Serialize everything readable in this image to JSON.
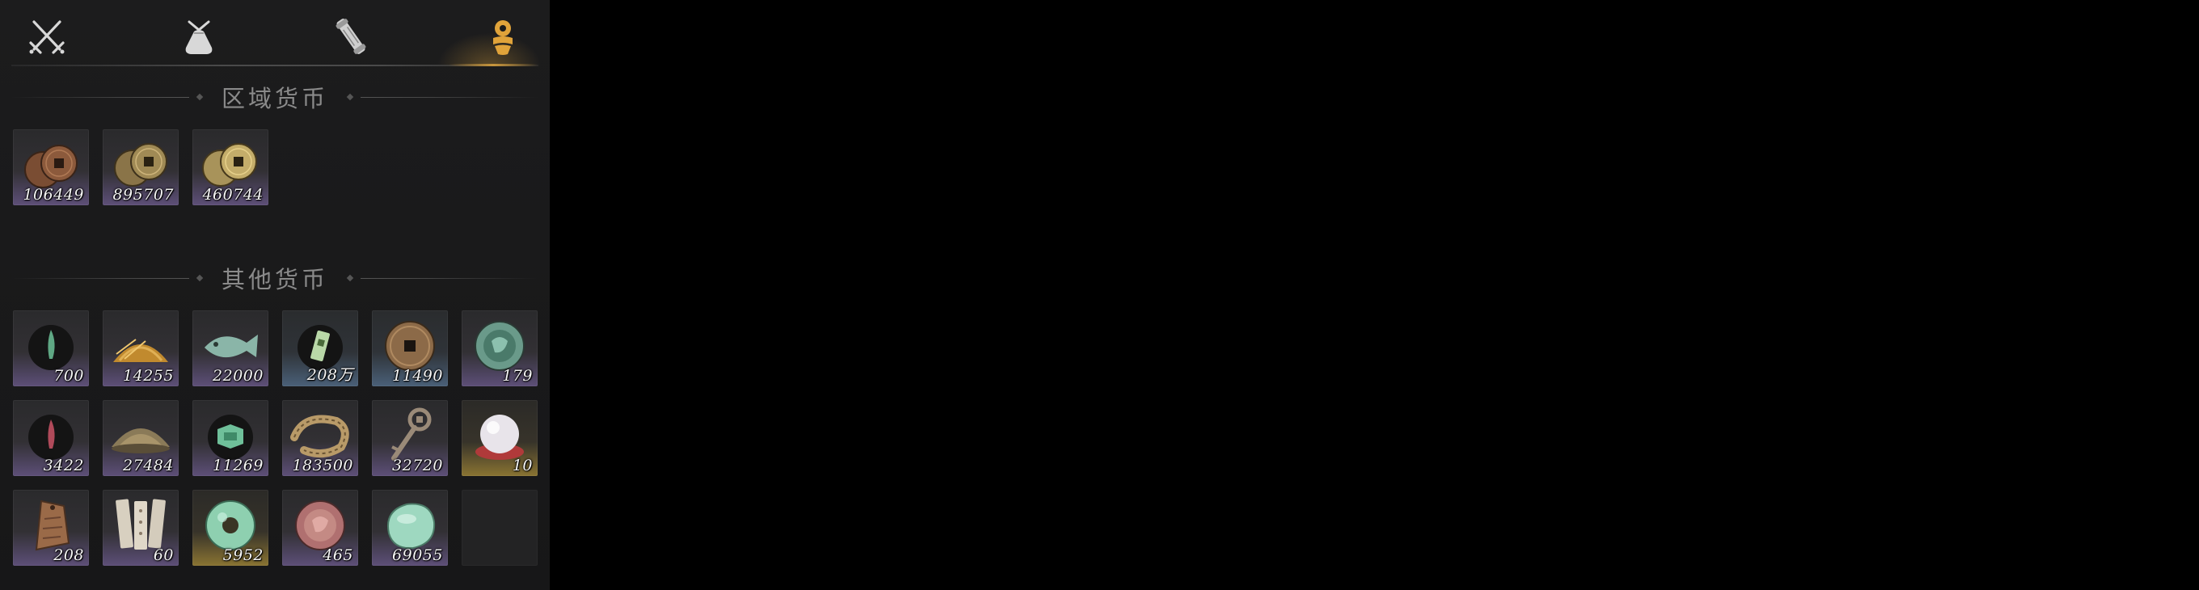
{
  "tabs": [
    {
      "icon": "crossed-swords-icon",
      "active": false
    },
    {
      "icon": "pouch-icon",
      "active": false
    },
    {
      "icon": "scroll-icon",
      "active": false
    },
    {
      "icon": "currency-icon",
      "active": true
    }
  ],
  "colors": {
    "accent": "#c8963c",
    "rarity_purple": "#5d4f78",
    "rarity_blue": "#4a6078",
    "rarity_gold": "#8a7432"
  },
  "regional_currency": {
    "title": "区域货币",
    "items": [
      {
        "icon": "copper-coins-icon",
        "count": "106449"
      },
      {
        "icon": "bronze-coins-icon",
        "count": "895707"
      },
      {
        "icon": "gold-coins-icon",
        "count": "460744"
      }
    ]
  },
  "other_currency": {
    "title": "其他货币",
    "items": [
      {
        "icon": "jade-feather-icon",
        "count": "700",
        "rarity": "purple"
      },
      {
        "icon": "grain-pile-icon",
        "count": "14255",
        "rarity": "purple"
      },
      {
        "icon": "jade-fish-icon",
        "count": "22000",
        "rarity": "purple"
      },
      {
        "icon": "banknote-icon",
        "count": "208万",
        "rarity": "blue"
      },
      {
        "icon": "square-hole-coin-icon",
        "count": "11490",
        "rarity": "blue"
      },
      {
        "icon": "jade-medallion-icon",
        "count": "179",
        "rarity": "purple"
      },
      {
        "icon": "red-feather-icon",
        "count": "3422",
        "rarity": "purple"
      },
      {
        "icon": "silver-ingot-icon",
        "count": "27484",
        "rarity": "purple"
      },
      {
        "icon": "jade-token-icon",
        "count": "11269",
        "rarity": "purple"
      },
      {
        "icon": "coin-string-icon",
        "count": "183500",
        "rarity": "purple"
      },
      {
        "icon": "key-icon",
        "count": "32720",
        "rarity": "purple"
      },
      {
        "icon": "pearl-icon",
        "count": "10",
        "rarity": "gold"
      },
      {
        "icon": "copper-tablet-icon",
        "count": "208",
        "rarity": "purple"
      },
      {
        "icon": "paper-slips-icon",
        "count": "60",
        "rarity": "purple"
      },
      {
        "icon": "jade-disc-icon",
        "count": "5952",
        "rarity": "gold"
      },
      {
        "icon": "red-medallion-icon",
        "count": "465",
        "rarity": "purple"
      },
      {
        "icon": "jade-stone-icon",
        "count": "69055",
        "rarity": "purple"
      },
      {
        "icon": "",
        "count": "",
        "rarity": "empty"
      }
    ]
  }
}
